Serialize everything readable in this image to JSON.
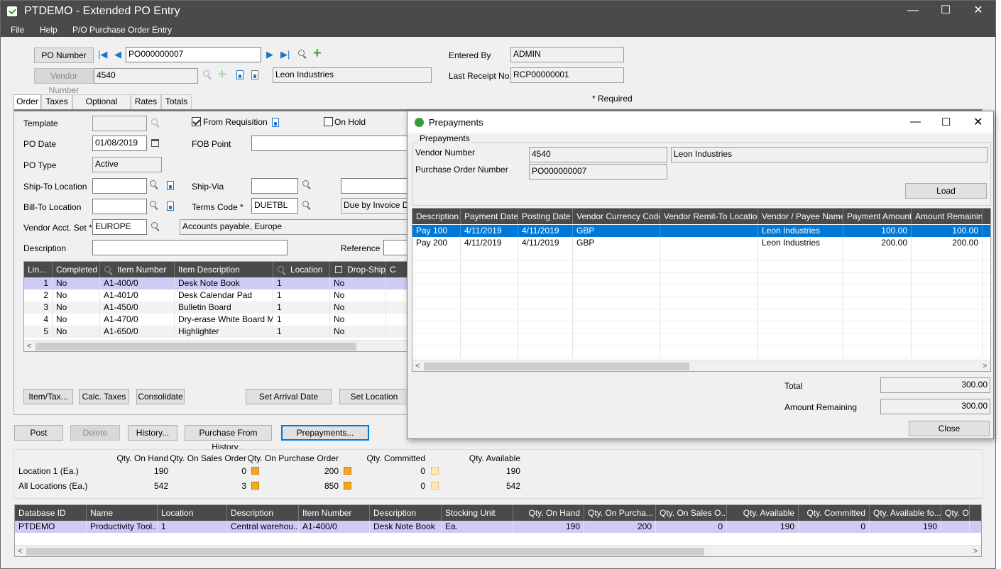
{
  "window": {
    "title": "PTDEMO - Extended PO Entry",
    "min": "—",
    "max": "☐",
    "close": "✕"
  },
  "menu": [
    "File",
    "Help",
    "P/O Purchase Order Entry"
  ],
  "header": {
    "po_number_btn": "PO Number",
    "po_number": "PO000000007",
    "vendor_number_btn": "Vendor Number",
    "vendor_number": "4540",
    "vendor_name": "Leon Industries",
    "entered_by_label": "Entered By",
    "entered_by": "ADMIN",
    "last_receipt_label": "Last Receipt No.",
    "last_receipt": "RCP00000001",
    "required_note": "*  Required"
  },
  "tabs": [
    "Order",
    "Taxes",
    "Optional Fields",
    "Rates",
    "Totals"
  ],
  "order": {
    "template_label": "Template",
    "template": "",
    "from_requisition": "From Requisition",
    "on_hold": "On Hold",
    "po_date_label": "PO Date",
    "po_date": "01/08/2019",
    "fob_label": "FOB Point",
    "fob": "",
    "po_type_label": "PO Type",
    "po_type": "Active",
    "ship_to_label": "Ship-To Location",
    "ship_to": "",
    "ship_via_label": "Ship-Via",
    "ship_via": "",
    "bill_to_label": "Bill-To Location",
    "bill_to": "",
    "terms_label": "Terms Code *",
    "terms": "DUETBL",
    "terms_desc": "Due by Invoice Date",
    "acct_set_label": "Vendor Acct. Set *",
    "acct_set": "EUROPE",
    "acct_set_desc": "Accounts payable, Europe",
    "description_label": "Description",
    "description": "",
    "reference_label": "Reference",
    "reference": ""
  },
  "lines": {
    "headers": [
      "Lin...",
      "Completed",
      "Item Number",
      "Item Description",
      "Location",
      "Drop-Ship",
      "C"
    ],
    "rows": [
      [
        "1",
        "No",
        "A1-400/0",
        "Desk Note Book",
        "1",
        "No"
      ],
      [
        "2",
        "No",
        "A1-401/0",
        "Desk Calendar Pad",
        "1",
        "No"
      ],
      [
        "3",
        "No",
        "A1-450/0",
        "Bulletin Board",
        "1",
        "No"
      ],
      [
        "4",
        "No",
        "A1-470/0",
        "Dry-erase White Board M...",
        "1",
        "No"
      ],
      [
        "5",
        "No",
        "A1-650/0",
        "Highlighter",
        "1",
        "No"
      ]
    ]
  },
  "line_buttons": [
    "Item/Tax...",
    "Calc. Taxes",
    "Consolidate",
    "Set Arrival Date",
    "Set Location"
  ],
  "action_buttons": {
    "post": "Post",
    "delete": "Delete",
    "history": "History...",
    "purchase_history": "Purchase From History...",
    "prepayments": "Prepayments..."
  },
  "qty": {
    "headers": [
      "Qty. On Hand",
      "Qty. On Sales Order",
      "Qty. On Purchase Order",
      "Qty. Committed",
      "Qty. Available"
    ],
    "rows": [
      {
        "label": "Location 1 (Ea.)",
        "values": [
          "190",
          "0",
          "200",
          "0",
          "190"
        ]
      },
      {
        "label": "All Locations  (Ea.)",
        "values": [
          "542",
          "3",
          "850",
          "0",
          "542"
        ]
      }
    ]
  },
  "db": {
    "headers": [
      "Database ID",
      "Name",
      "Location",
      "Description",
      "Item Number",
      "Description",
      "Stocking Unit",
      "Qty. On Hand",
      "Qty. On Purcha...",
      "Qty. On Sales O...",
      "Qty. Available",
      "Qty. Committed",
      "Qty. Available fo...",
      "Qty. On Han"
    ],
    "rows": [
      [
        "PTDEMO",
        "Productivity Tool...",
        "1",
        "Central warehou...",
        "A1-400/0",
        "Desk Note Book",
        "Ea.",
        "190",
        "200",
        "0",
        "190",
        "0",
        "190",
        ""
      ]
    ]
  },
  "dialog": {
    "title": "Prepayments",
    "group": "Prepayments",
    "vendor_label": "Vendor Number",
    "vendor": "4540",
    "vendor_name": "Leon Industries",
    "po_label": "Purchase Order Number",
    "po": "PO000000007",
    "load": "Load",
    "headers": [
      "Description",
      "Payment Date",
      "Posting Date",
      "Vendor Currency Code",
      "Vendor Remit-To Location",
      "Vendor / Payee Name",
      "Payment Amount",
      "Amount Remaining"
    ],
    "rows": [
      [
        "Pay 100",
        "4/11/2019",
        "4/11/2019",
        "GBP",
        "",
        "Leon Industries",
        "100.00",
        "100.00"
      ],
      [
        "Pay 200",
        "4/11/2019",
        "4/11/2019",
        "GBP",
        "",
        "Leon Industries",
        "200.00",
        "200.00"
      ]
    ],
    "total_label": "Total",
    "total": "300.00",
    "remaining_label": "Amount Remaining",
    "remaining": "300.00",
    "close": "Close"
  }
}
